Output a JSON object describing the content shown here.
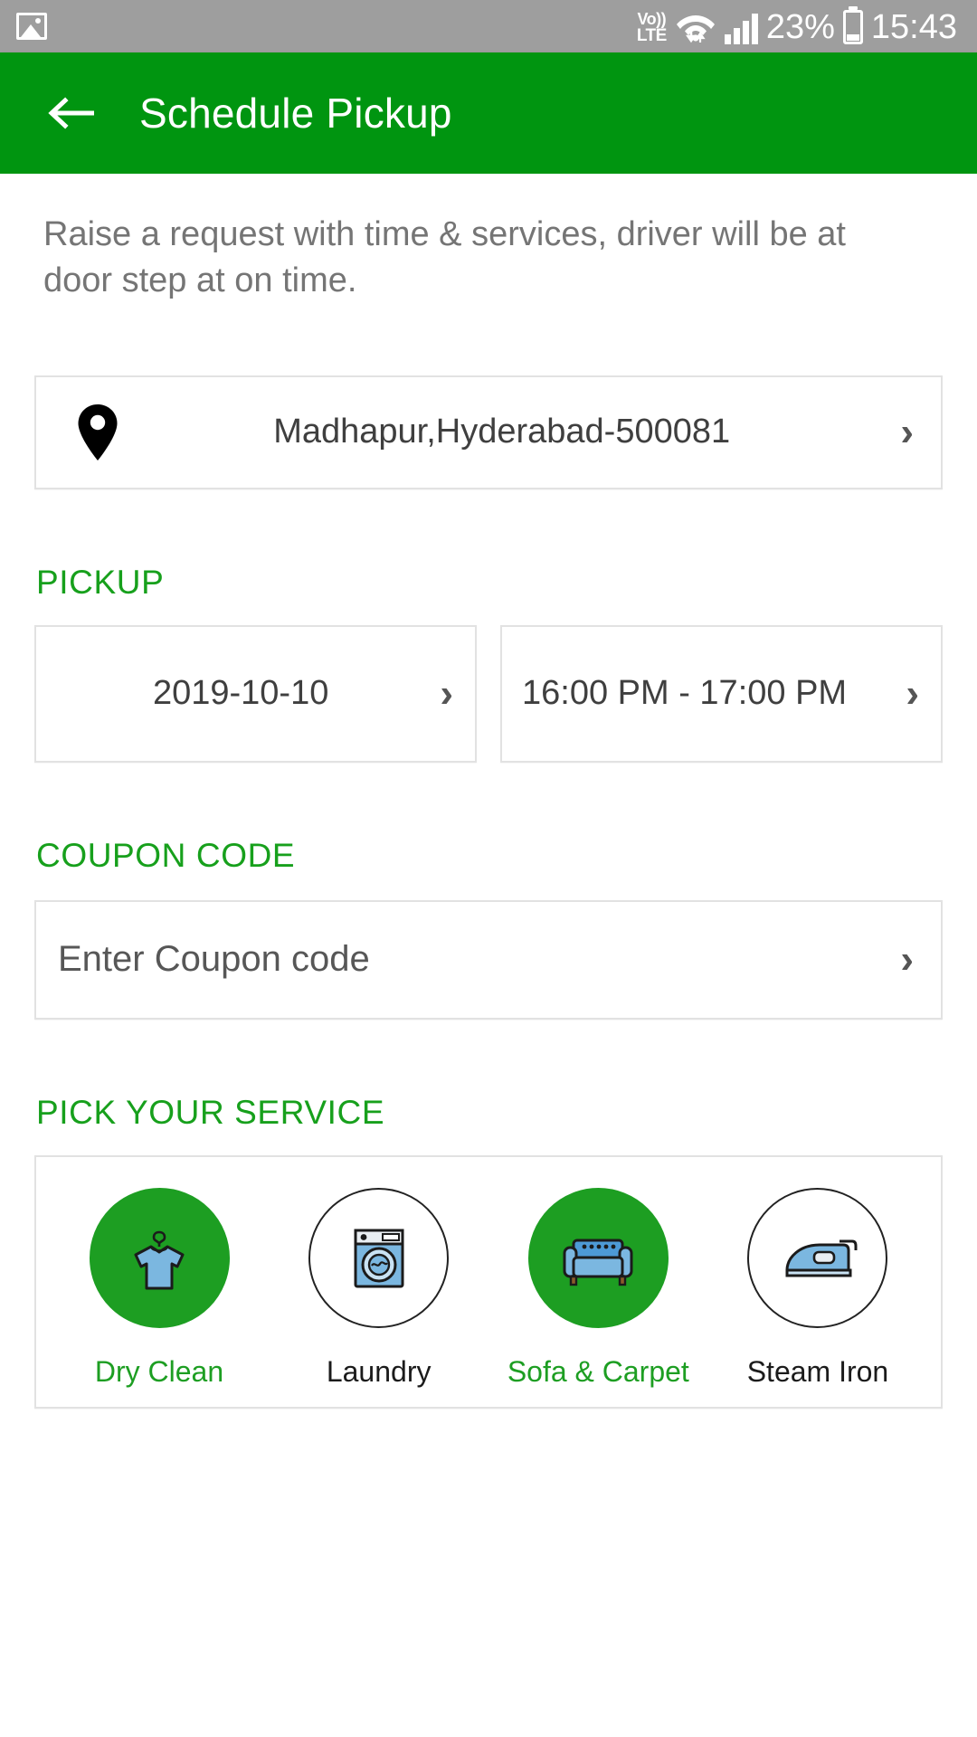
{
  "status_bar": {
    "image_icon": "image-icon",
    "volte_top": "Vo))",
    "volte_bottom": "LTE",
    "wifi_icon": "wifi-icon",
    "signal_icon": "signal-bars-icon",
    "battery_percent": "23%",
    "battery_icon": "battery-icon",
    "time": "15:43",
    "bg_color": "#9e9e9e"
  },
  "app_bar": {
    "back_icon": "back-arrow-icon",
    "title": "Schedule Pickup",
    "bg_color": "#009510"
  },
  "intro": {
    "text": "Raise a request with time & services,  driver will be at door step at on time."
  },
  "location": {
    "pin_icon": "map-pin-icon",
    "address": "Madhapur,Hyderabad-500081",
    "chevron": "›"
  },
  "pickup": {
    "heading": "PICKUP",
    "date_value": "2019-10-10",
    "time_value": "16:00 PM - 17:00 PM",
    "chevron": "›"
  },
  "coupon": {
    "heading": "COUPON CODE",
    "placeholder": "Enter Coupon code",
    "value": "",
    "chevron": "›"
  },
  "services": {
    "heading": "PICK YOUR SERVICE",
    "accent_color": "#1d9e22",
    "items": [
      {
        "label": "Dry Clean",
        "icon": "tshirt-hanger-icon",
        "selected": true
      },
      {
        "label": "Laundry",
        "icon": "washing-machine-icon",
        "selected": false
      },
      {
        "label": "Sofa & Carpet",
        "icon": "sofa-icon",
        "selected": true
      },
      {
        "label": "Steam Iron",
        "icon": "clothes-iron-icon",
        "selected": false
      }
    ]
  }
}
